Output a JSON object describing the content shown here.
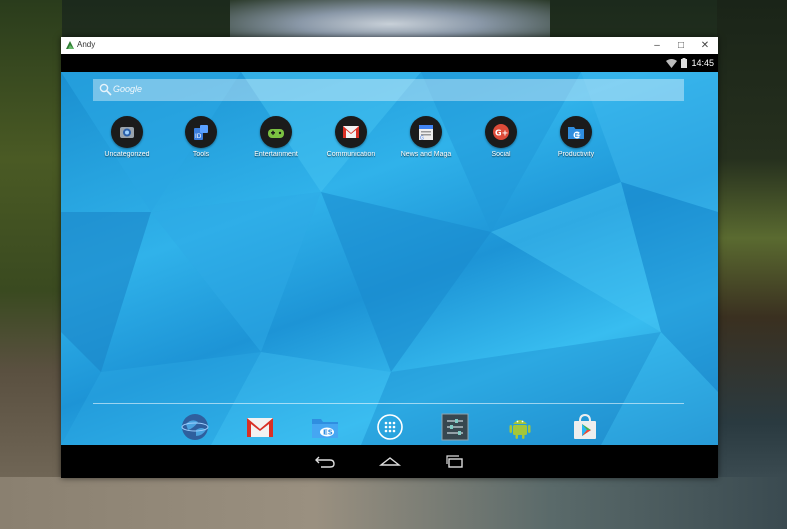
{
  "window": {
    "title": "Andy"
  },
  "status": {
    "time": "14:45"
  },
  "search": {
    "placeholder": "Google"
  },
  "folders": [
    {
      "label": "Uncategorized",
      "icon": "camera-icon"
    },
    {
      "label": "Tools",
      "icon": "tools-icon"
    },
    {
      "label": "Entertainment",
      "icon": "game-controller-icon"
    },
    {
      "label": "Communication",
      "icon": "gmail-icon"
    },
    {
      "label": "News and Maga",
      "icon": "calendar-icon"
    },
    {
      "label": "Social",
      "icon": "google-plus-icon"
    },
    {
      "label": "Productivity",
      "icon": "file-manager-icon"
    }
  ],
  "dock": [
    "browser-globe-icon",
    "gmail-icon",
    "es-file-explorer-icon",
    "app-drawer-icon",
    "settings-icon",
    "android-icon",
    "play-store-icon"
  ],
  "colors": {
    "wallpaper_accent": "#30b2ea",
    "navbar": "#000000"
  }
}
